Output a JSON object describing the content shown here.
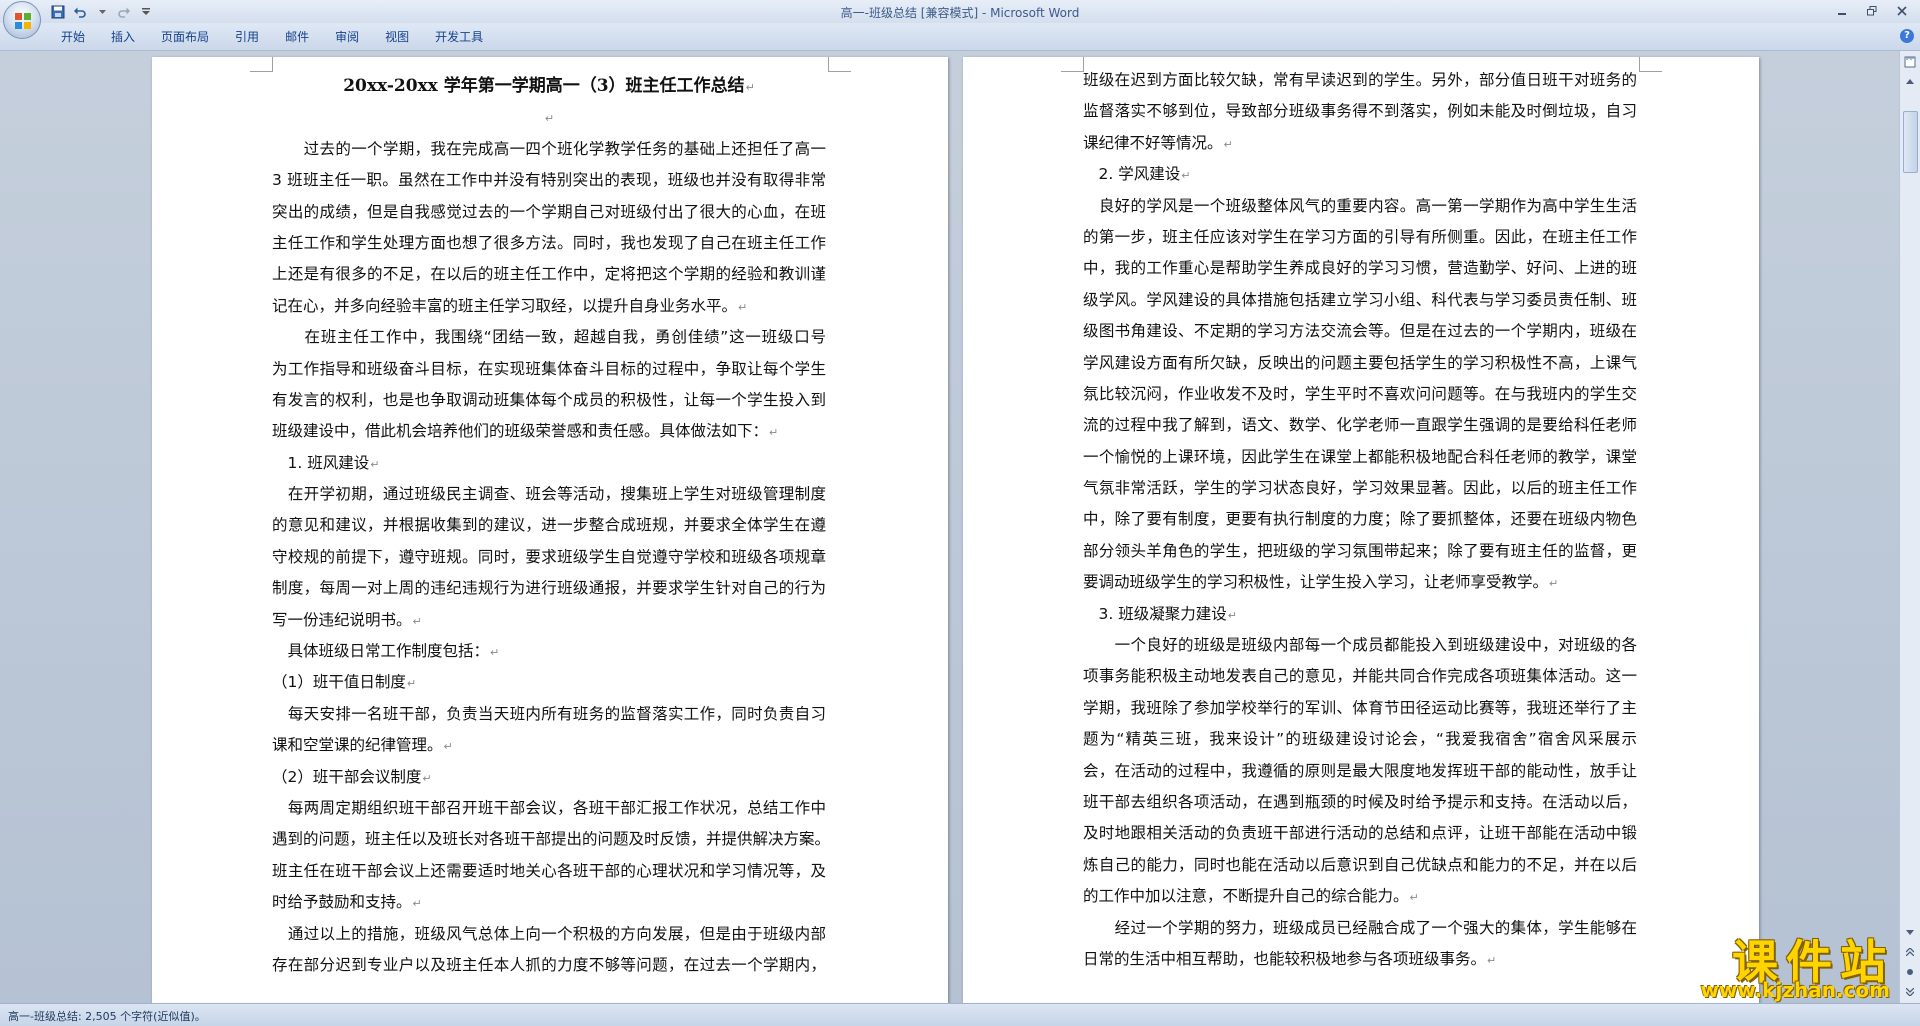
{
  "window": {
    "title": "高一-班级总结 [兼容模式] - Microsoft Word"
  },
  "ribbon": {
    "tabs": [
      "开始",
      "插入",
      "页面布局",
      "引用",
      "邮件",
      "审阅",
      "视图",
      "开发工具"
    ],
    "help_label": "?"
  },
  "document": {
    "paragraph_mark": "↵",
    "left_page": {
      "lines": [
        {
          "text": "20xx-20xx 学年第一学期高一（3）班主任工作总结",
          "style": "heading"
        },
        {
          "text": "",
          "style": "center"
        },
        {
          "text": "　　过去的一个学期，我在完成高一四个班化学教学任务的基础上还担任了高一",
          "style": "justify"
        },
        {
          "text": "3 班班主任一职。虽然在工作中并没有特别突出的表现，班级也并没有取得非常",
          "style": "justify"
        },
        {
          "text": "突出的成绩，但是自我感觉过去的一个学期自己对班级付出了很大的心血，在班",
          "style": "justify"
        },
        {
          "text": "主任工作和学生处理方面也想了很多方法。同时，我也发现了自己在班主任工作",
          "style": "justify"
        },
        {
          "text": "上还是有很多的不足，在以后的班主任工作中，定将把这个学期的经验和教训谨",
          "style": "justify"
        },
        {
          "text": "记在心，并多向经验丰富的班主任学习取经，以提升自身业务水平。",
          "style": "end"
        },
        {
          "text": "　　在班主任工作中，我围绕“团结一致，超越自我，勇创佳绩”这一班级口号",
          "style": "justify"
        },
        {
          "text": "为工作指导和班级奋斗目标，在实现班集体奋斗目标的过程中，争取让每个学生",
          "style": "justify"
        },
        {
          "text": "有发言的权利，也是也争取调动班集体每个成员的积极性，让每一个学生投入到",
          "style": "justify"
        },
        {
          "text": "班级建设中，借此机会培养他们的班级荣誉感和责任感。具体做法如下：",
          "style": "end"
        },
        {
          "text": "　1. 班风建设",
          "style": "end"
        },
        {
          "text": "　在开学初期，通过班级民主调查、班会等活动，搜集班上学生对班级管理制度",
          "style": "justify"
        },
        {
          "text": "的意见和建议，并根据收集到的建议，进一步整合成班规，并要求全体学生在遵",
          "style": "justify"
        },
        {
          "text": "守校规的前提下，遵守班规。同时，要求班级学生自觉遵守学校和班级各项规章",
          "style": "justify"
        },
        {
          "text": "制度，每周一对上周的违纪违规行为进行班级通报，并要求学生针对自己的行为",
          "style": "justify"
        },
        {
          "text": "写一份违纪说明书。",
          "style": "end"
        },
        {
          "text": "　具体班级日常工作制度包括：",
          "style": "end"
        },
        {
          "text": "（1）班干值日制度",
          "style": "end"
        },
        {
          "text": "　每天安排一名班干部，负责当天班内所有班务的监督落实工作，同时负责自习",
          "style": "justify"
        },
        {
          "text": "课和空堂课的纪律管理。",
          "style": "end"
        },
        {
          "text": "（2）班干部会议制度",
          "style": "end"
        },
        {
          "text": "　每两周定期组织班干部召开班干部会议，各班干部汇报工作状况，总结工作中",
          "style": "justify"
        },
        {
          "text": "遇到的问题，班主任以及班长对各班干部提出的问题及时反馈，并提供解决方案。",
          "style": "justify"
        },
        {
          "text": "班主任在班干部会议上还需要适时地关心各班干部的心理状况和学习情况等，及",
          "style": "justify"
        },
        {
          "text": "时给予鼓励和支持。",
          "style": "end"
        },
        {
          "text": "　通过以上的措施，班级风气总体上向一个积极的方向发展，但是由于班级内部",
          "style": "justify"
        },
        {
          "text": "存在部分迟到专业户以及班主任本人抓的力度不够等问题，在过去一个学期内，",
          "style": "justify"
        }
      ]
    },
    "right_page": {
      "lines": [
        {
          "text": "班级在迟到方面比较欠缺，常有早读迟到的学生。另外，部分值日班干对班务的",
          "style": "justify"
        },
        {
          "text": "监督落实不够到位，导致部分班级事务得不到落实，例如未能及时倒垃圾，自习",
          "style": "justify"
        },
        {
          "text": "课纪律不好等情况。",
          "style": "end"
        },
        {
          "text": "　2. 学风建设",
          "style": "end"
        },
        {
          "text": "　良好的学风是一个班级整体风气的重要内容。高一第一学期作为高中学生生活",
          "style": "justify"
        },
        {
          "text": "的第一步，班主任应该对学生在学习方面的引导有所侧重。因此，在班主任工作",
          "style": "justify"
        },
        {
          "text": "中，我的工作重心是帮助学生养成良好的学习习惯，营造勤学、好问、上进的班",
          "style": "justify"
        },
        {
          "text": "级学风。学风建设的具体措施包括建立学习小组、科代表与学习委员责任制、班",
          "style": "justify"
        },
        {
          "text": "级图书角建设、不定期的学习方法交流会等。但是在过去的一个学期内，班级在",
          "style": "justify"
        },
        {
          "text": "学风建设方面有所欠缺，反映出的问题主要包括学生的学习积极性不高，上课气",
          "style": "justify"
        },
        {
          "text": "氛比较沉闷，作业收发不及时，学生平时不喜欢问问题等。在与我班内的学生交",
          "style": "justify"
        },
        {
          "text": "流的过程中我了解到，语文、数学、化学老师一直跟学生强调的是要给科任老师",
          "style": "justify"
        },
        {
          "text": "一个愉悦的上课环境，因此学生在课堂上都能积极地配合科任老师的教学，课堂",
          "style": "justify"
        },
        {
          "text": "气氛非常活跃，学生的学习状态良好，学习效果显著。因此，以后的班主任工作",
          "style": "justify"
        },
        {
          "text": "中，除了要有制度，更要有执行制度的力度；除了要抓整体，还要在班级内物色",
          "style": "justify"
        },
        {
          "text": "部分领头羊角色的学生，把班级的学习氛围带起来；除了要有班主任的监督，更",
          "style": "justify"
        },
        {
          "text": "要调动班级学生的学习积极性，让学生投入学习，让老师享受教学。",
          "style": "end"
        },
        {
          "text": "　3. 班级凝聚力建设",
          "style": "end"
        },
        {
          "text": "　　一个良好的班级是班级内部每一个成员都能投入到班级建设中，对班级的各",
          "style": "justify"
        },
        {
          "text": "项事务能积极主动地发表自己的意见，并能共同合作完成各项班集体活动。这一",
          "style": "justify"
        },
        {
          "text": "学期，我班除了参加学校举行的军训、体育节田径运动比赛等，我班还举行了主",
          "style": "justify"
        },
        {
          "text": "题为“精英三班，我来设计”的班级建设讨论会，“我爱我宿舍”宿舍风采展示",
          "style": "justify"
        },
        {
          "text": "会，在活动的过程中，我遵循的原则是最大限度地发挥班干部的能动性，放手让",
          "style": "justify"
        },
        {
          "text": "班干部去组织各项活动，在遇到瓶颈的时候及时给予提示和支持。在活动以后，",
          "style": "justify"
        },
        {
          "text": "及时地跟相关活动的负责班干部进行活动的总结和点评，让班干部能在活动中锻",
          "style": "justify"
        },
        {
          "text": "炼自己的能力，同时也能在活动以后意识到自己优缺点和能力的不足，并在以后",
          "style": "justify"
        },
        {
          "text": "的工作中加以注意，不断提升自己的综合能力。",
          "style": "end"
        },
        {
          "text": "　　经过一个学期的努力，班级成员已经融合成了一个强大的集体，学生能够在",
          "style": "justify"
        },
        {
          "text": "日常的生活中相互帮助，也能较积极地参与各项班级事务。",
          "style": "end"
        }
      ]
    }
  },
  "statusbar": {
    "text": "高一-班级总结: 2,505 个字符(近似值)。"
  },
  "watermark": {
    "title": "课件站",
    "url": "www.kjzhan.com"
  },
  "colors": {
    "ribbon_text": "#15428b",
    "title_text": "#3d5a8a",
    "workspace": "#c5cfdc",
    "watermark": "#ffd400"
  }
}
